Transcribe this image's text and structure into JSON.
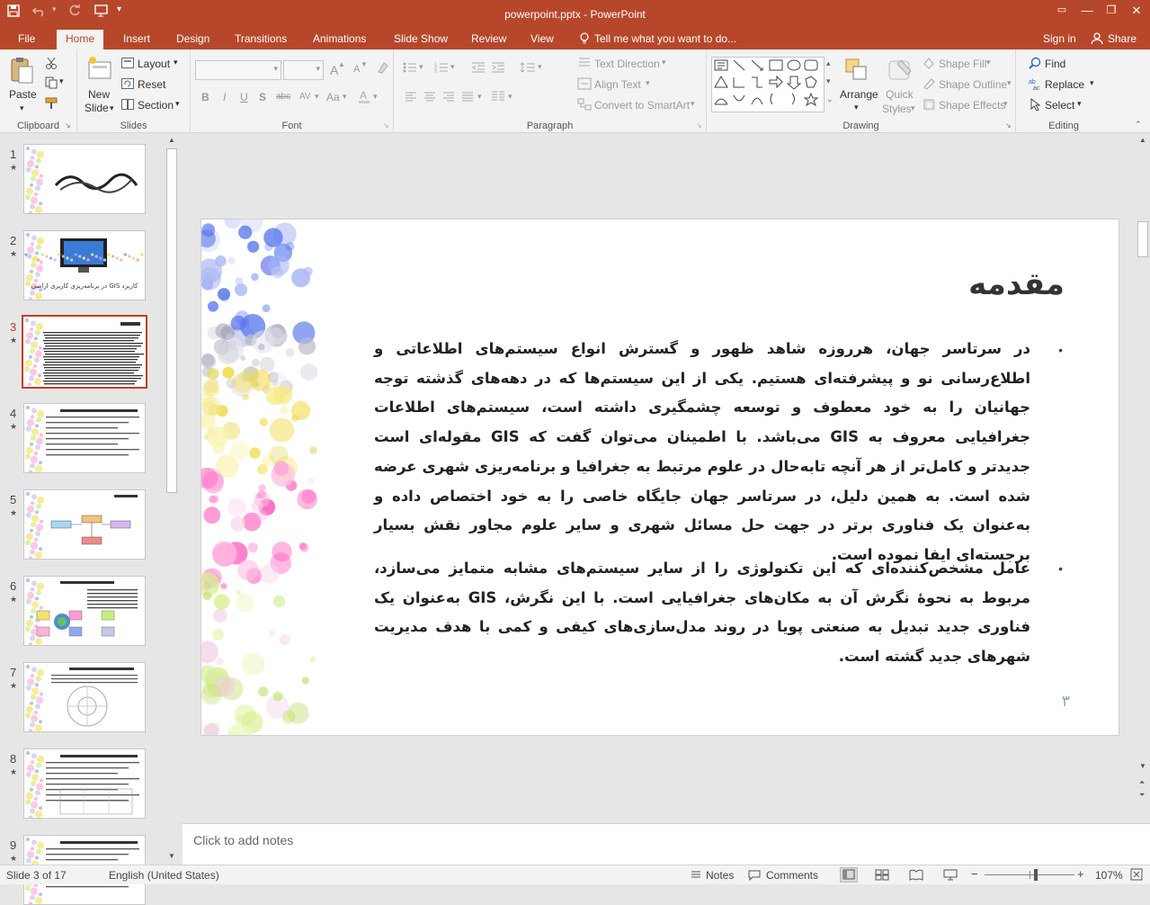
{
  "app": {
    "window_title": "powerpoint.pptx - PowerPoint",
    "accent": "#b7472a",
    "qat": [
      "save-icon",
      "undo-icon",
      "redo-icon",
      "present-from-start-icon",
      "customize-qat-icon"
    ],
    "window_buttons": [
      "ribbon-display-options-icon",
      "minimize-icon",
      "restore-icon",
      "close-icon"
    ]
  },
  "tabs": {
    "file": "File",
    "home": "Home",
    "insert": "Insert",
    "design": "Design",
    "transitions": "Transitions",
    "animations": "Animations",
    "slideshow": "Slide Show",
    "review": "Review",
    "view": "View",
    "tellme": "Tell me what you want to do...",
    "signin": "Sign in",
    "share": "Share"
  },
  "ribbon": {
    "clipboard": {
      "label": "Clipboard",
      "paste": "Paste"
    },
    "slides": {
      "label": "Slides",
      "new_slide_1": "New",
      "new_slide_2": "Slide",
      "layout": "Layout",
      "reset": "Reset",
      "section": "Section"
    },
    "font": {
      "label": "Font",
      "bold": "B",
      "italic": "I",
      "underline": "U",
      "shadow": "S",
      "strike": "abc",
      "spacing": "AV",
      "case": "Aa",
      "grow": "A",
      "shrink": "A"
    },
    "paragraph": {
      "label": "Paragraph",
      "text_direction": "Text Direction",
      "align_text": "Align Text",
      "smartart": "Convert to SmartArt"
    },
    "drawing": {
      "label": "Drawing",
      "arrange": "Arrange",
      "quick_styles_1": "Quick",
      "quick_styles_2": "Styles",
      "shape_fill": "Shape Fill",
      "shape_outline": "Shape Outline",
      "shape_effects": "Shape Effects"
    },
    "editing": {
      "label": "Editing",
      "find": "Find",
      "replace": "Replace",
      "select": "Select"
    }
  },
  "thumbnails": [
    {
      "num": "1",
      "selected": false
    },
    {
      "num": "2",
      "selected": false,
      "caption": "کاربرد GIS در برنامه‌ریزی کاربری اراضی"
    },
    {
      "num": "3",
      "selected": true
    },
    {
      "num": "4",
      "selected": false
    },
    {
      "num": "5",
      "selected": false
    },
    {
      "num": "6",
      "selected": false
    },
    {
      "num": "7",
      "selected": false
    },
    {
      "num": "8",
      "selected": false
    },
    {
      "num": "9",
      "selected": false
    }
  ],
  "slide": {
    "title": "مقدمه",
    "paragraph1": "در سرتاسر جهان، هرروزه شاهد ظهور و گسترش انواع سیستم‌های اطلاعاتی و اطلاع‌رسانی نو و پیشرفته‌ای هستیم. یکی از این سیستم‌ها که در دهه‌های گذشته توجه جهانیان را به خود معطوف و توسعه چشمگیری داشته است، سیستم‌های اطلاعات جغرافیایی معروف به GIS می‌باشد. با اطمینان می‌توان گفت که GIS مقوله‌ای است جدیدتر و کامل‌تر از هر آنچه تابه‌حال در علوم مرتبط به جغرافیا و برنامه‌ریزی شهری عرضه شده است. به همین دلیل، در سرتاسر جهان جایگاه خاصی را به خود اختصاص داده و به‌عنوان یک فناوری برتر در جهت حل مسائل شهری و سایر علوم مجاور نقش بسیار برجسته‌ای ایفا نموده است.",
    "paragraph2": "عامل مشخص‌کننده‌ای که این تکنولوژی را از سایر سیستم‌های مشابه متمایز می‌سازد، مربوط به نحوهٔ نگرش آن به مکان‌های جغرافیایی است. با این نگرش، GIS به‌عنوان یک فناوری جدید تبدیل به صنعتی پویا در روند مدل‌سازی‌های کیفی و کمی با هدف مدیریت شهرهای جدید گشته است.",
    "page_number": "۳"
  },
  "notes": {
    "placeholder": "Click to add notes"
  },
  "status": {
    "slide_info": "Slide 3 of 17",
    "language": "English (United States)",
    "notes": "Notes",
    "comments": "Comments",
    "zoom": "107%",
    "zoom_level": 0.57
  }
}
